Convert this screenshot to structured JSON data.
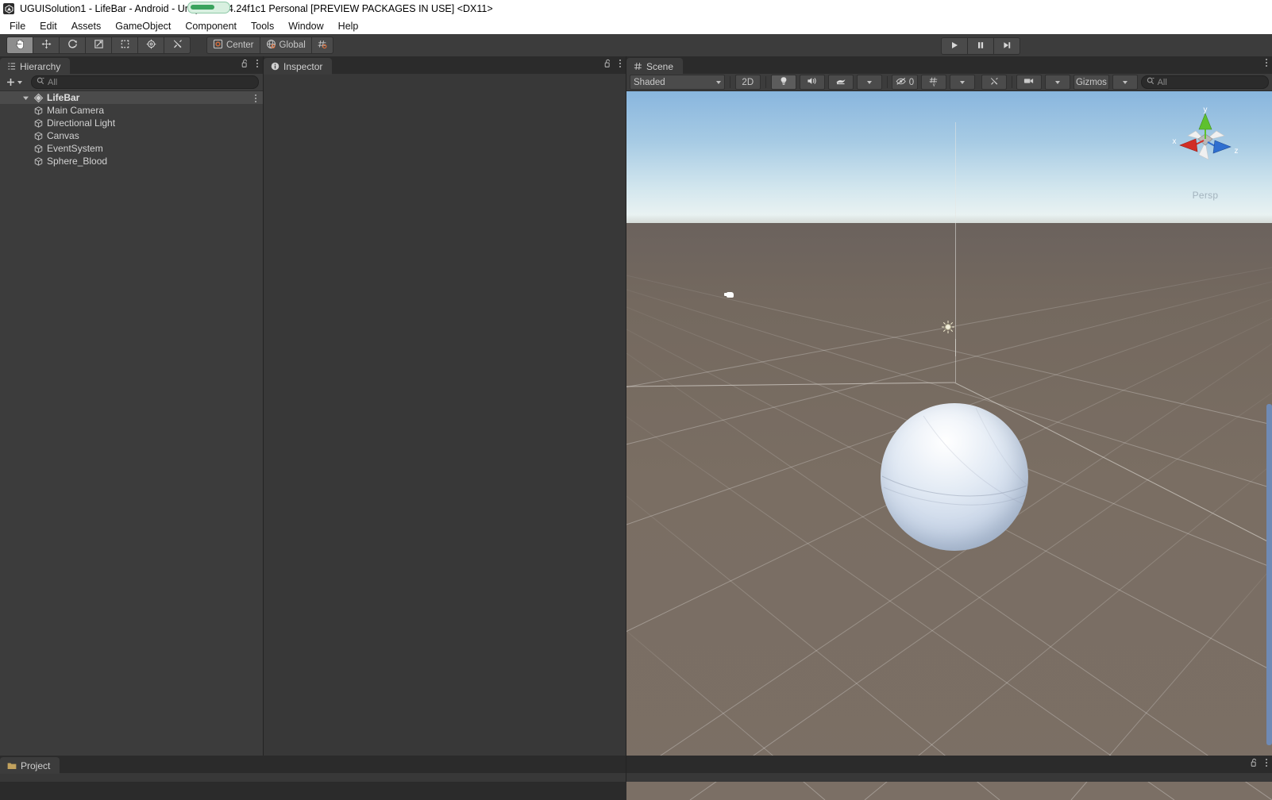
{
  "window": {
    "title": "UGUISolution1 - LifeBar - Android - Unity 2019.4.24f1c1 Personal [PREVIEW PACKAGES IN USE] <DX11>",
    "app_icon": "unity-icon"
  },
  "menubar": {
    "items": [
      {
        "label": "File"
      },
      {
        "label": "Edit"
      },
      {
        "label": "Assets"
      },
      {
        "label": "GameObject"
      },
      {
        "label": "Component"
      },
      {
        "label": "Tools"
      },
      {
        "label": "Window"
      },
      {
        "label": "Help"
      }
    ]
  },
  "toolbar": {
    "transform_tools": [
      {
        "name": "hand-tool",
        "icon": "hand-icon",
        "active": true
      },
      {
        "name": "move-tool",
        "icon": "move-icon",
        "active": false
      },
      {
        "name": "rotate-tool",
        "icon": "rotate-icon",
        "active": false
      },
      {
        "name": "scale-tool",
        "icon": "scale-icon",
        "active": false
      },
      {
        "name": "rect-tool",
        "icon": "rect-icon",
        "active": false
      },
      {
        "name": "transform-tool",
        "icon": "transform-icon",
        "active": false
      },
      {
        "name": "custom-editor-tool",
        "icon": "wrench-hammer-icon",
        "active": false
      }
    ],
    "pivot_label": "Center",
    "handle_label": "Global",
    "grid_snap_icon": "grid-snapping-icon",
    "play_controls": [
      {
        "name": "play-button",
        "icon": "play-icon"
      },
      {
        "name": "pause-button",
        "icon": "pause-icon"
      },
      {
        "name": "step-button",
        "icon": "step-icon"
      }
    ]
  },
  "hierarchy": {
    "tab_label": "Hierarchy",
    "tab_icon": "hierarchy-icon",
    "add_label": "+",
    "search_placeholder": "All",
    "lock_icon": "lock-open-icon",
    "menu_icon": "kebab-menu-icon",
    "scene": {
      "label": "LifeBar",
      "icon": "scene-icon",
      "expanded": true
    },
    "objects": [
      {
        "label": "Main Camera",
        "icon": "gameobject-icon"
      },
      {
        "label": "Directional Light",
        "icon": "gameobject-icon"
      },
      {
        "label": "Canvas",
        "icon": "gameobject-icon"
      },
      {
        "label": "EventSystem",
        "icon": "gameobject-icon"
      },
      {
        "label": "Sphere_Blood",
        "icon": "gameobject-icon"
      }
    ]
  },
  "inspector": {
    "tab_label": "Inspector",
    "tab_icon": "info-icon",
    "lock_icon": "lock-open-icon",
    "menu_icon": "kebab-menu-icon"
  },
  "scene": {
    "tab_label": "Scene",
    "tab_icon": "scene-grid-icon",
    "menu_icon": "kebab-menu-icon",
    "draw_mode": "Shaded",
    "mode_2d_label": "2D",
    "lighting_icon": "lightbulb-icon",
    "audio_icon": "audio-icon",
    "effects_icon": "effects-icon",
    "hidden_count": "0",
    "hidden_icon": "eye-off-icon",
    "scene_vis_icon": "scene-visibility-icon",
    "tools_icon": "tools-icon",
    "camera_icon": "camera-icon",
    "gizmos_label": "Gizmos",
    "search_placeholder": "All",
    "view_gizmo": {
      "x_label": "x",
      "y_label": "y",
      "z_label": "z",
      "projection_label": "Persp",
      "x_color": "#d12e26",
      "y_color": "#5ec12e",
      "z_color": "#2f6fd0"
    },
    "content": {
      "sphere_name": "Sphere_Blood",
      "light_gizmo": "directional-light-gizmo",
      "camera_gizmo": "main-camera-gizmo",
      "sky_top_color": "#89b6de",
      "sky_horizon_color": "#e9f2f2",
      "ground_color": "#7a6e63"
    }
  },
  "project": {
    "tab_label": "Project",
    "tab_icon": "folder-icon",
    "lock_icon": "lock-open-icon",
    "menu_icon": "kebab-menu-icon"
  }
}
